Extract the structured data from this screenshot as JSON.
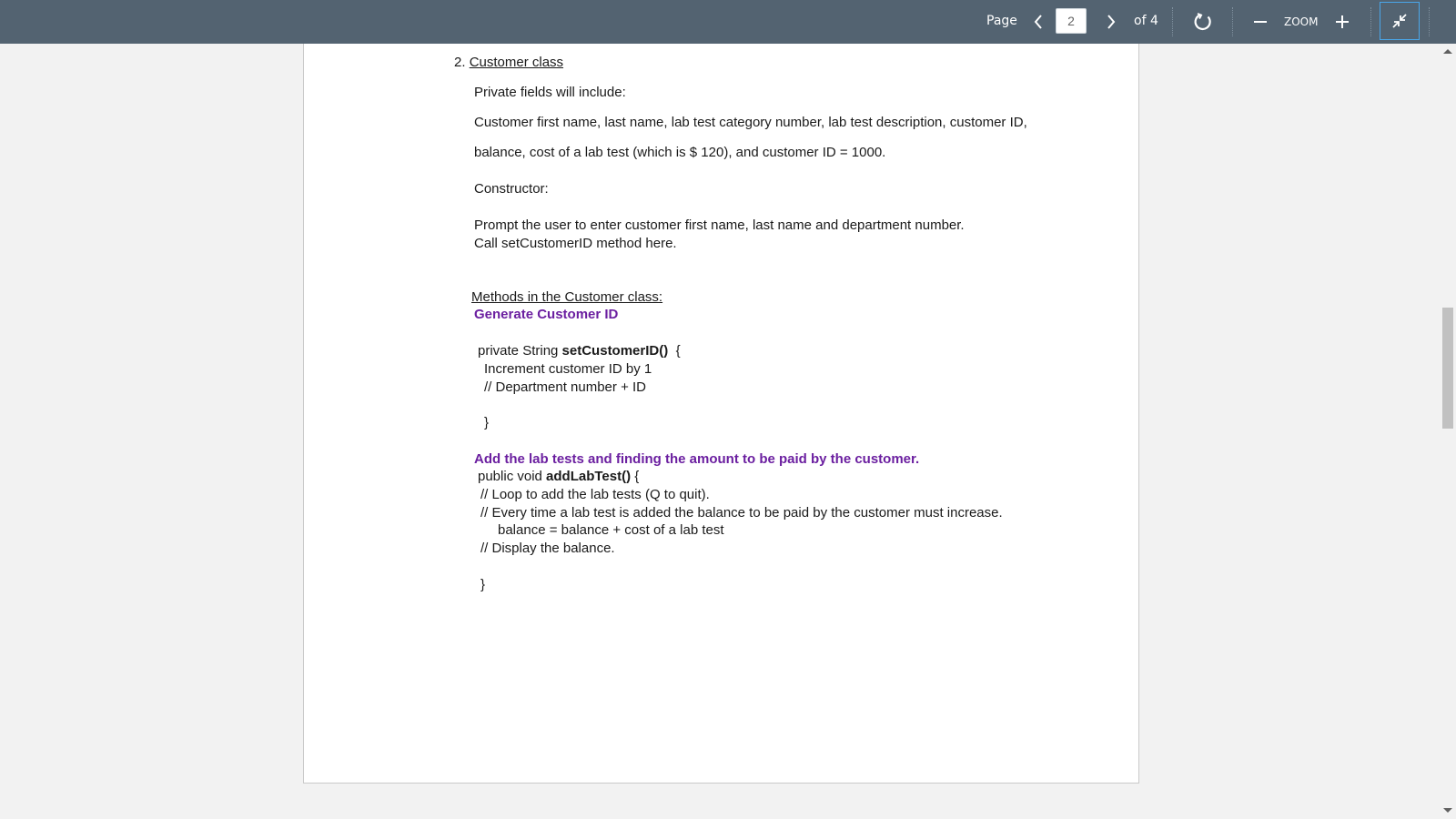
{
  "toolbar": {
    "page_label": "Page",
    "page_value": "2",
    "page_total": "of 4",
    "zoom_label": "ZOOM",
    "background": "#536371",
    "icons": {
      "prev": "chevron-left-icon",
      "next": "chevron-right-icon",
      "rotate": "rotate-icon",
      "zoom_out": "minus-icon",
      "zoom_in": "plus-icon",
      "exit_fullscreen": "exit-fullscreen-icon"
    }
  },
  "document": {
    "heading_number": "2.",
    "heading_title": "Customer class",
    "private_fields_label": "Private fields will include:",
    "fields_line1": "Customer first name, last name, lab test category number, lab test description, customer ID,",
    "fields_line2": "balance, cost of a lab test (which is $ 120), and customer ID = 1000.",
    "constructor_label": "Constructor:",
    "constructor_line1": "Prompt the user to enter customer first name, last name and department number.",
    "constructor_line2": "Call setCustomerID method here.",
    "methods_heading": "Methods in the Customer class:",
    "generate_id_title": "Generate Customer ID",
    "method1_prefix": "private String ",
    "method1_name": "setCustomerID()",
    "method1_suffix": "  {",
    "method1_line1": "Increment customer ID by 1",
    "method1_line2": "// Department number + ID",
    "method1_close": "}",
    "add_tests_title": "Add the lab tests and finding the amount to be paid by the customer.",
    "method2_prefix": "public void ",
    "method2_name": "addLabTest()",
    "method2_suffix": " {",
    "method2_line1": "// Loop to add the lab tests (Q to quit).",
    "method2_line2": "// Every time a lab test is added the balance to be paid by the customer must increase.",
    "method2_line3": "balance = balance + cost of a lab test",
    "method2_line4": "// Display the balance.",
    "method2_close": "}",
    "accent_color": "#6b1fa0"
  }
}
